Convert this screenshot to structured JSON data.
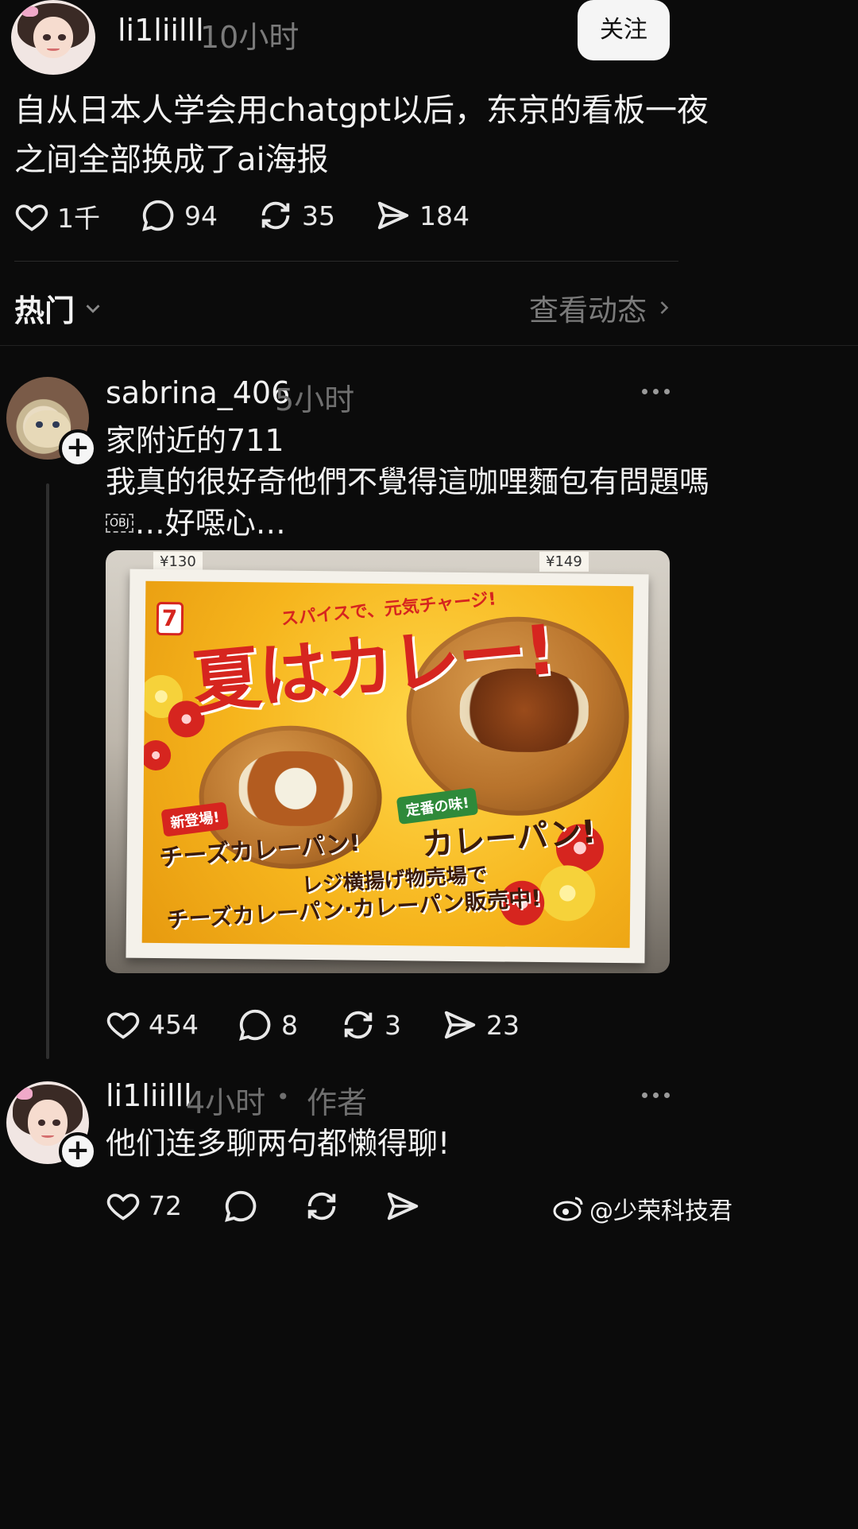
{
  "post": {
    "username": "li1liilll",
    "time": "10小时",
    "follow_label": "关注",
    "text_line1": "自从日本人学会用chatgpt以后，东京的看板一夜",
    "text_line2": "之间全部换成了ai海报",
    "actions": {
      "likes": "1千",
      "comments": "94",
      "reposts": "35",
      "shares": "184"
    }
  },
  "section": {
    "title": "热门",
    "link": "查看动态"
  },
  "reply1": {
    "username": "sabrina_406",
    "time": "5小时",
    "text_line1": "家附近的711",
    "text_line2": "我真的很好奇他們不覺得這咖哩麵包有問題嗎",
    "text_line3_obj": "OBJ",
    "text_line3": "…好噁心…",
    "actions": {
      "likes": "454",
      "comments": "8",
      "reposts": "3",
      "shares": "23"
    },
    "poster": {
      "headline": "夏はカレー!",
      "subhead": "スパイスで、元気チャージ!",
      "logo": "7",
      "tag_new": "新登場!",
      "label_cheese": "チーズカレーパン!",
      "tag_classic": "定番の味!",
      "label_curry": "カレーパン!",
      "bottom_line1": "レジ横揚げ物売場で",
      "bottom_line2": "チーズカレーパン·カレーパン販売中!",
      "price_left": "¥130",
      "price_right": "¥149"
    }
  },
  "reply2": {
    "username": "li1liilll",
    "time": "4小时",
    "separator": "•",
    "author_badge": "作者",
    "text": "他们连多聊两句都懒得聊!",
    "actions": {
      "likes": "72"
    }
  },
  "watermark": {
    "text": "@少荣科技君"
  },
  "colors": {
    "background": "#0b0b0b",
    "text": "#f2f2f2",
    "muted": "#7a7a7a",
    "accent_red": "#d6251f"
  }
}
